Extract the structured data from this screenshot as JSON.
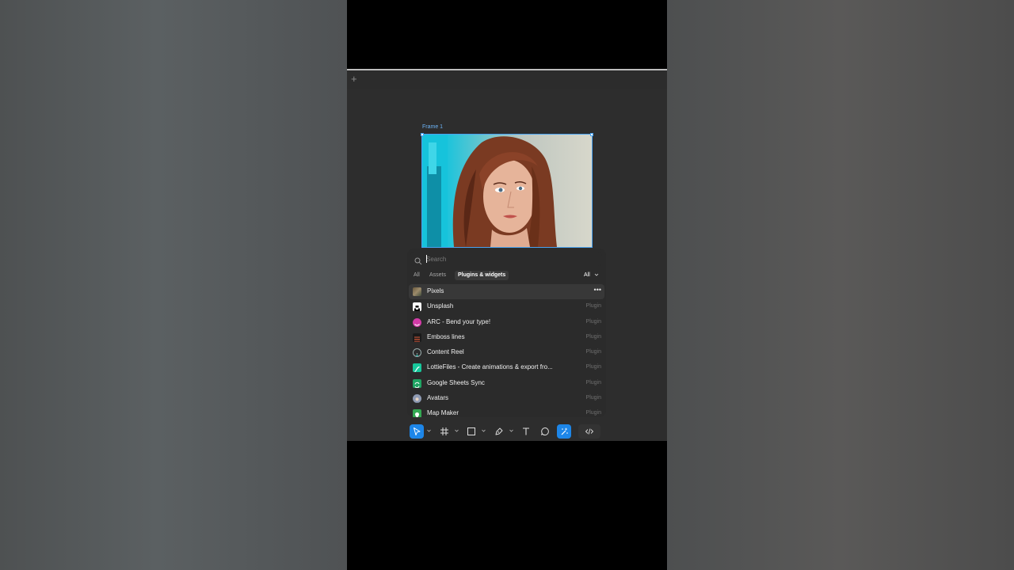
{
  "canvas": {
    "add_label": "+",
    "frame_label": "Frame 1"
  },
  "panel": {
    "search_placeholder": "Search",
    "tabs": [
      {
        "label": "All",
        "active": false
      },
      {
        "label": "Assets",
        "active": false
      },
      {
        "label": "Plugins & widgets",
        "active": true
      }
    ],
    "filter_label": "All",
    "items": [
      {
        "name": "Pixels",
        "type": "",
        "icon": "pixels-icon",
        "hover": true
      },
      {
        "name": "Unsplash",
        "type": "Plugin",
        "icon": "unsplash-icon"
      },
      {
        "name": "ARC - Bend your type!",
        "type": "Plugin",
        "icon": "arc-icon"
      },
      {
        "name": "Emboss lines",
        "type": "Plugin",
        "icon": "emboss-lines-icon"
      },
      {
        "name": "Content Reel",
        "type": "Plugin",
        "icon": "content-reel-icon"
      },
      {
        "name": "LottieFiles - Create animations & export fro...",
        "type": "Plugin",
        "icon": "lottiefiles-icon"
      },
      {
        "name": "Google Sheets Sync",
        "type": "Plugin",
        "icon": "google-sheets-sync-icon"
      },
      {
        "name": "Avatars",
        "type": "Plugin",
        "icon": "avatars-icon"
      },
      {
        "name": "Map Maker",
        "type": "Plugin",
        "icon": "map-maker-icon"
      }
    ],
    "more_label": "•••"
  },
  "toolbar": {
    "tools": [
      "move-tool-icon",
      "frame-tool-icon",
      "rectangle-tool-icon",
      "pen-tool-icon",
      "text-tool-icon",
      "comment-tool-icon",
      "actions-tool-icon",
      "dev-mode-icon"
    ],
    "active": [
      "move-tool-icon",
      "actions-tool-icon"
    ]
  },
  "colors": {
    "accent": "#1d86e8",
    "canvas": "#2d2d2d",
    "panel": "#2b2b2b",
    "frame_label": "#6cb2f5"
  }
}
